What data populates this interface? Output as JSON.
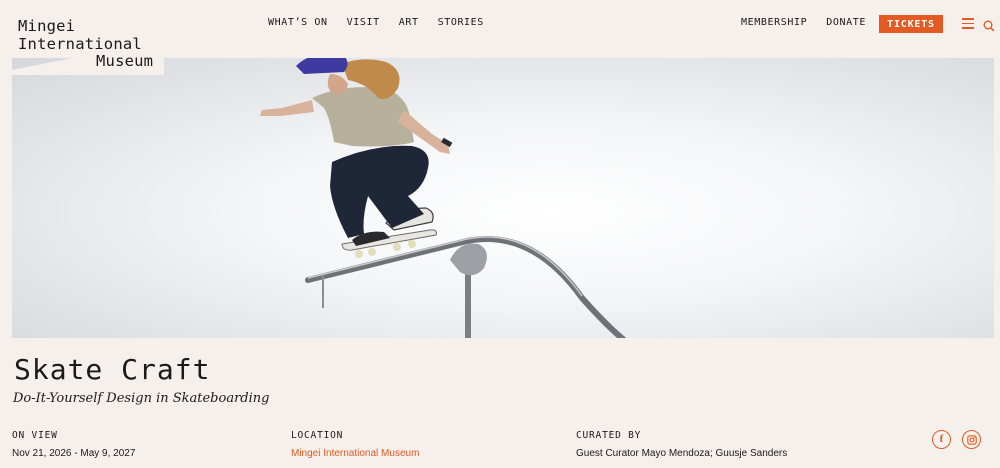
{
  "header": {
    "logo_lines": [
      "Mingei",
      "International",
      "Museum"
    ],
    "nav_main": [
      "WHAT’S ON",
      "VISIT",
      "ART",
      "STORIES"
    ],
    "nav_right": [
      "MEMBERSHIP",
      "DONATE"
    ],
    "tickets_label": "TICKETS",
    "icons": {
      "menu": "hamburger-menu-icon",
      "search": "search-icon"
    },
    "accent_color": "#e35a22"
  },
  "hero": {
    "image_subject": "skateboarder grinding on a curved metal rail against a white background"
  },
  "exhibition": {
    "title": "Skate Craft",
    "subtitle": "Do-It-Yourself Design in Skateboarding",
    "on_view_label": "ON VIEW",
    "on_view_value": "Nov 21, 2026 - May 9, 2027",
    "location_label": "LOCATION",
    "location_value": "Mingei International Museum",
    "curated_label": "CURATED BY",
    "curated_value": "Guest Curator Mayo Mendoza; Guusje Sanders"
  },
  "social": {
    "icons": [
      "facebook-icon",
      "instagram-icon"
    ]
  },
  "colors": {
    "background": "#f5f0eb",
    "accent": "#e35a22",
    "text": "#1a1a1a"
  }
}
